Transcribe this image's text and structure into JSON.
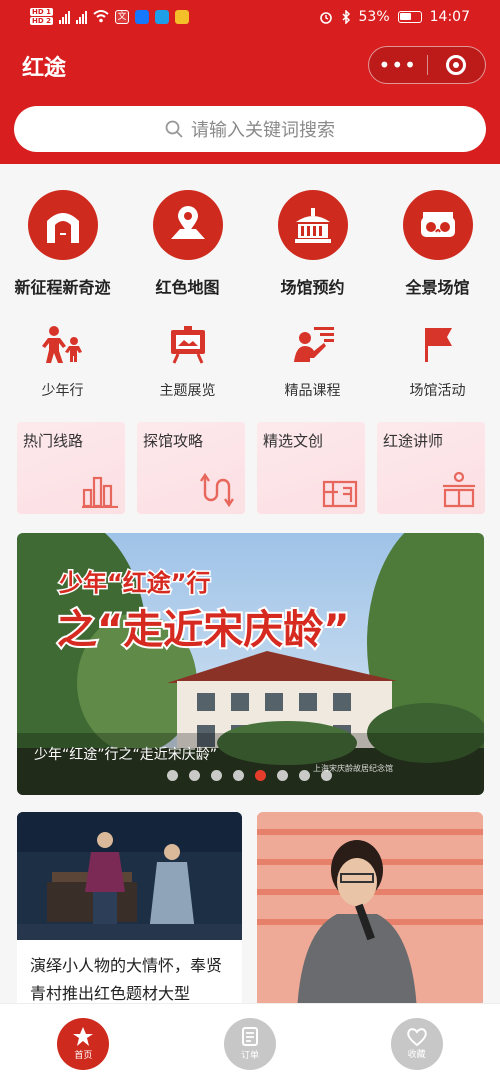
{
  "status_bar": {
    "network_1": "HD 1",
    "network_2": "HD 2",
    "battery_percent": "53%",
    "time": "14:07"
  },
  "app": {
    "title": "红途"
  },
  "capsule": {
    "more_icon": "more-dots-icon",
    "close_icon": "target-icon"
  },
  "search": {
    "placeholder": "请输入关键词搜索"
  },
  "main_icons": [
    {
      "label": "新征程新奇迹",
      "icon": "arch-icon"
    },
    {
      "label": "红色地图",
      "icon": "map-pin-icon"
    },
    {
      "label": "场馆预约",
      "icon": "building-icon"
    },
    {
      "label": "全景场馆",
      "icon": "vr-glasses-icon"
    }
  ],
  "sub_icons": [
    {
      "label": "少年行",
      "icon": "children-icon"
    },
    {
      "label": "主题展览",
      "icon": "easel-icon"
    },
    {
      "label": "精品课程",
      "icon": "lecturer-icon"
    },
    {
      "label": "场馆活动",
      "icon": "flag-icon"
    }
  ],
  "quick_cards": [
    {
      "label": "热门线路",
      "icon": "bar-chart-icon"
    },
    {
      "label": "探馆攻略",
      "icon": "route-arrows-icon"
    },
    {
      "label": "精选文创",
      "icon": "gift-box-icon"
    },
    {
      "label": "红途讲师",
      "icon": "podium-icon"
    }
  ],
  "banner": {
    "headline_line1": "少年“红途”行",
    "headline_line2": "之“走近宋庆龄”",
    "watermark": "上海宋庆龄故居纪念馆",
    "caption": "少年“红途”行之“走近宋庆龄”",
    "dots_total": 8,
    "active_dot": 5
  },
  "feed": [
    {
      "title": "演绎小人物的大情怀，奉贤青村推出红色题材大型"
    },
    {
      "title": ""
    }
  ],
  "tab_bar": [
    {
      "label": "首页",
      "icon": "star-icon",
      "active": true
    },
    {
      "label": "订单",
      "icon": "order-icon",
      "active": false
    },
    {
      "label": "收藏",
      "icon": "heart-icon",
      "active": false
    }
  ],
  "colors": {
    "brand_red": "#d81e1e",
    "icon_red": "#cf2a1e",
    "card_pink": "#fde9ec"
  }
}
